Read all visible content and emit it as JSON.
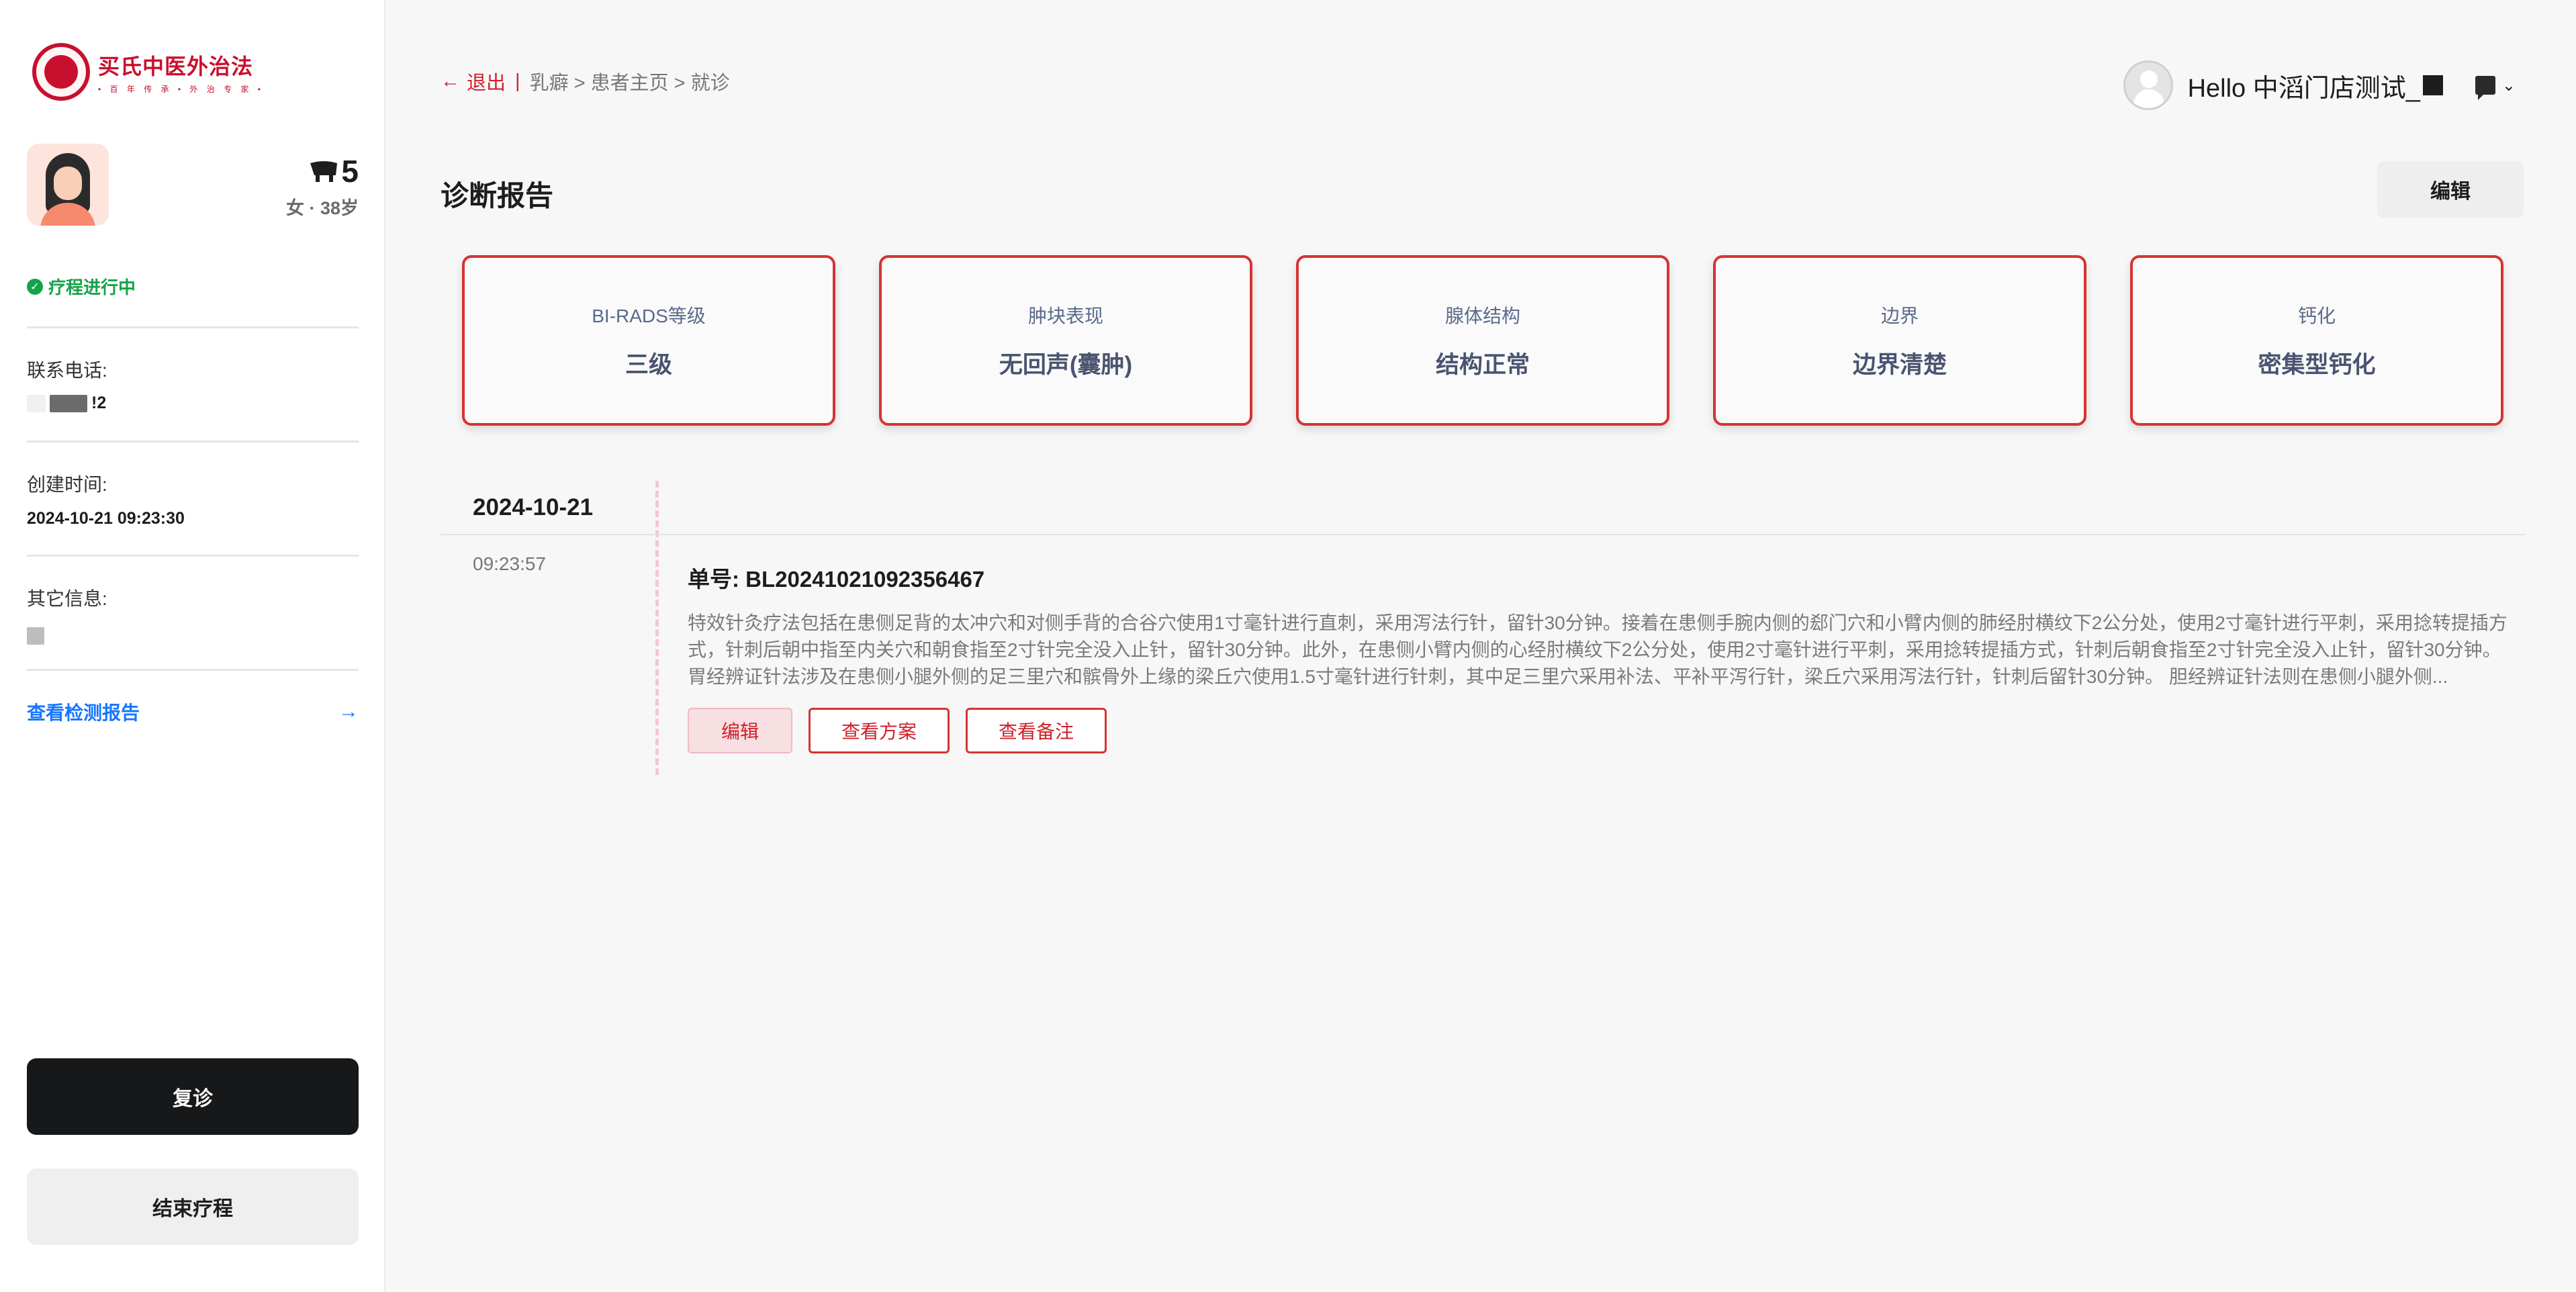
{
  "brand": {
    "name": "买氏中医外治法",
    "tagline": "• 百 年 传 承 • 外 治 专 家 •"
  },
  "patient": {
    "number": "5",
    "meta": "女 · 38岁",
    "status": "疗程进行中"
  },
  "contact": {
    "phone_label": "联系电话:",
    "phone_suffix": "!2"
  },
  "created": {
    "label": "创建时间:",
    "value": "2024-10-21 09:23:30"
  },
  "other": {
    "label": "其它信息:"
  },
  "sidebar_links": {
    "report": "查看检测报告"
  },
  "sidebar_actions": {
    "revisit": "复诊",
    "end": "结束疗程"
  },
  "breadcrumb": {
    "back": "退出",
    "sep": "|",
    "path": "乳癖 > 患者主页 > 就诊"
  },
  "user": {
    "greeting": "Hello 中滔门店测试_"
  },
  "report": {
    "title": "诊断报告",
    "edit_label": "编辑",
    "cards": [
      {
        "label": "BI-RADS等级",
        "value": "三级"
      },
      {
        "label": "肿块表现",
        "value": "无回声(囊肿)"
      },
      {
        "label": "腺体结构",
        "value": "结构正常"
      },
      {
        "label": "边界",
        "value": "边界清楚"
      },
      {
        "label": "钙化",
        "value": "密集型钙化"
      }
    ]
  },
  "timeline": {
    "date": "2024-10-21",
    "records": [
      {
        "time": "09:23:57",
        "number": "单号: BL20241021092356467",
        "text": "特效针灸疗法包括在患侧足背的太冲穴和对侧手背的合谷穴使用1寸毫针进行直刺，采用泻法行针，留针30分钟。接着在患侧手腕内侧的郄门穴和小臂内侧的肺经肘横纹下2公分处，使用2寸毫针进行平刺，采用捻转提插方式，针刺后朝中指至内关穴和朝食指至2寸针完全没入止针，留针30分钟。此外，在患侧小臂内侧的心经肘横纹下2公分处，使用2寸毫针进行平刺，采用捻转提插方式，针刺后朝食指至2寸针完全没入止针，留针30分钟。 胃经辨证针法涉及在患侧小腿外侧的足三里穴和髌骨外上缘的梁丘穴使用1.5寸毫针进行针刺，其中足三里穴采用补法、平补平泻行针，梁丘穴采用泻法行针，针刺后留针30分钟。 胆经辨证针法则在患侧小腿外侧...",
        "actions": {
          "edit": "编辑",
          "plan": "查看方案",
          "note": "查看备注"
        }
      }
    ]
  },
  "colors": {
    "accent": "#d0202b",
    "card_border": "#d63333",
    "status": "#15a34a",
    "link": "#1677ff"
  }
}
